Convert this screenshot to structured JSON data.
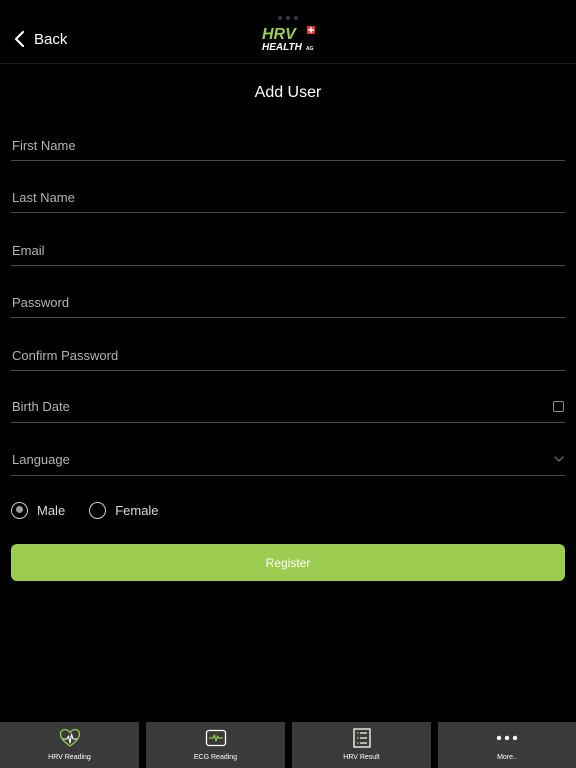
{
  "header": {
    "back_label": "Back",
    "logo_text_top": "HRV",
    "logo_text_bottom": "HEALTH",
    "logo_text_suffix": "AG"
  },
  "page": {
    "title": "Add User"
  },
  "form": {
    "first_name_placeholder": "First Name",
    "last_name_placeholder": "Last Name",
    "email_placeholder": "Email",
    "password_placeholder": "Password",
    "confirm_password_placeholder": "Confirm Password",
    "birth_date_label": "Birth Date",
    "language_label": "Language",
    "gender_options": [
      {
        "label": "Male",
        "selected": true
      },
      {
        "label": "Female",
        "selected": false
      }
    ],
    "register_label": "Register"
  },
  "tabbar": {
    "items": [
      {
        "label": "HRV Reading",
        "icon": "heart-pulse-icon"
      },
      {
        "label": "ECG Reading",
        "icon": "ecg-monitor-icon"
      },
      {
        "label": "HRV Result",
        "icon": "list-icon"
      },
      {
        "label": "More..",
        "icon": "more-dots-icon"
      }
    ]
  },
  "colors": {
    "accent": "#9ccc50",
    "background": "#000000",
    "tab_background": "#3a3a3a",
    "underline": "#4a4a4a",
    "logo_red": "#e53935"
  }
}
